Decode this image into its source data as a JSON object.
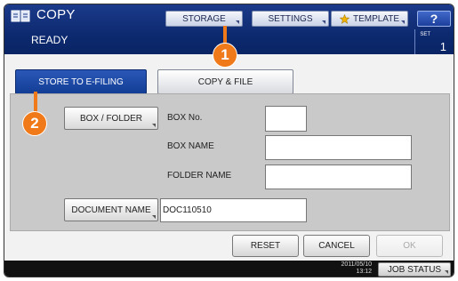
{
  "header": {
    "title": "COPY",
    "status": "READY",
    "set_label": "SET",
    "set_count": "1",
    "storage_label": "STORAGE",
    "settings_label": "SETTINGS",
    "template_label": "TEMPLATE",
    "help_label": "?"
  },
  "tabs": {
    "store_label": "STORE TO E-FILING",
    "copyfile_label": "COPY & FILE"
  },
  "form": {
    "box_folder_label": "BOX / FOLDER",
    "box_no_label": "BOX No.",
    "box_no_value": "",
    "box_name_label": "BOX NAME",
    "box_name_value": "",
    "folder_name_label": "FOLDER NAME",
    "folder_name_value": "",
    "document_name_button": "DOCUMENT NAME",
    "document_name_value": "DOC110510"
  },
  "actions": {
    "reset_label": "RESET",
    "cancel_label": "CANCEL",
    "ok_label": "OK"
  },
  "statusbar": {
    "date": "2011/05/10",
    "time": "13:12",
    "job_status_label": "JOB STATUS"
  },
  "callouts": {
    "one": "1",
    "two": "2"
  },
  "colors": {
    "header_bg": "#0d2a70",
    "active_tab": "#1b4aa8",
    "callout": "#f07a1a"
  }
}
